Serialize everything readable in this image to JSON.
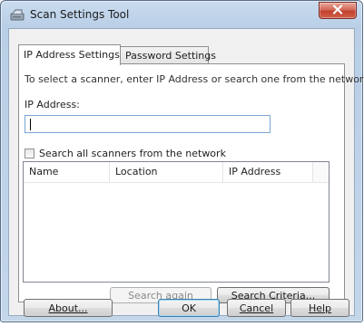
{
  "window": {
    "title": "Scan Settings Tool",
    "close_icon": "close-x-icon",
    "app_icon": "scanner-icon"
  },
  "tabs": [
    {
      "label": "IP Address Settings",
      "active": true
    },
    {
      "label": "Password Settings",
      "active": false
    }
  ],
  "ip_panel": {
    "instructions": "To select a scanner, enter IP Address or search one from the network.",
    "ip_label": "IP Address:",
    "ip_value": "",
    "search_all_label": "Search all scanners from the network",
    "search_all_checked": false,
    "columns": [
      "Name",
      "Location",
      "IP Address"
    ],
    "rows": [],
    "search_again_label": "Search again",
    "search_criteria_label": "Search Criteria..."
  },
  "footer": {
    "about_label": "About...",
    "ok_label": "OK",
    "cancel_label": "Cancel",
    "help_label": "Help"
  },
  "colors": {
    "window_frame": "#b9cfe7",
    "close_button": "#c2402c",
    "default_button_border": "#3c7fb1"
  }
}
